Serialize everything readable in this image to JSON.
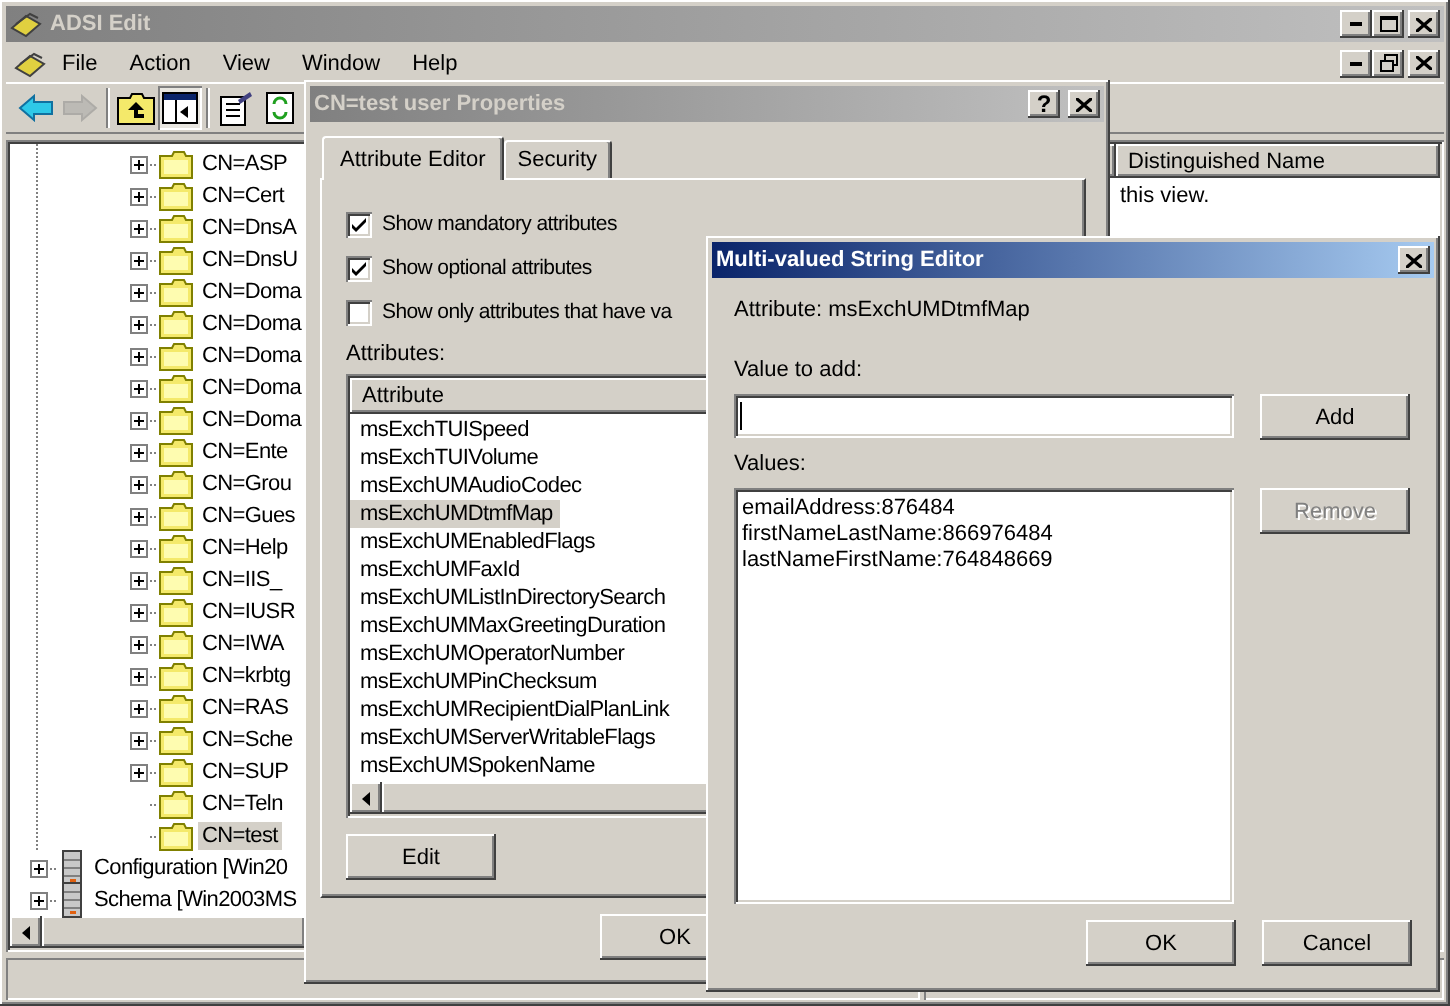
{
  "window": {
    "title": "ADSI Edit",
    "active": false
  },
  "menu": [
    {
      "label": "File"
    },
    {
      "label": "Action"
    },
    {
      "label": "View"
    },
    {
      "label": "Window"
    },
    {
      "label": "Help"
    }
  ],
  "toolbar": [
    {
      "kind": "back",
      "disabled": false
    },
    {
      "kind": "forward",
      "disabled": true
    },
    {
      "kind": "up",
      "disabled": false
    },
    {
      "kind": "tree",
      "disabled": false,
      "pressed": true
    },
    {
      "kind": "properties",
      "disabled": false
    },
    {
      "kind": "refresh",
      "disabled": false
    }
  ],
  "tree": {
    "folders": [
      {
        "label": "CN=ASP",
        "expandable": true,
        "selected": false
      },
      {
        "label": "CN=Cert",
        "expandable": true,
        "selected": false
      },
      {
        "label": "CN=DnsA",
        "expandable": true,
        "selected": false
      },
      {
        "label": "CN=DnsU",
        "expandable": true,
        "selected": false
      },
      {
        "label": "CN=Doma",
        "expandable": true,
        "selected": false
      },
      {
        "label": "CN=Doma",
        "expandable": true,
        "selected": false
      },
      {
        "label": "CN=Doma",
        "expandable": true,
        "selected": false
      },
      {
        "label": "CN=Doma",
        "expandable": true,
        "selected": false
      },
      {
        "label": "CN=Doma",
        "expandable": true,
        "selected": false
      },
      {
        "label": "CN=Ente",
        "expandable": true,
        "selected": false
      },
      {
        "label": "CN=Grou",
        "expandable": true,
        "selected": false
      },
      {
        "label": "CN=Gues",
        "expandable": true,
        "selected": false
      },
      {
        "label": "CN=Help",
        "expandable": true,
        "selected": false
      },
      {
        "label": "CN=IIS_",
        "expandable": true,
        "selected": false
      },
      {
        "label": "CN=IUSR",
        "expandable": true,
        "selected": false
      },
      {
        "label": "CN=IWA",
        "expandable": true,
        "selected": false
      },
      {
        "label": "CN=krbtg",
        "expandable": true,
        "selected": false
      },
      {
        "label": "CN=RAS",
        "expandable": true,
        "selected": false
      },
      {
        "label": "CN=Sche",
        "expandable": true,
        "selected": false
      },
      {
        "label": "CN=SUP",
        "expandable": true,
        "selected": false
      },
      {
        "label": "CN=Teln",
        "expandable": false,
        "selected": false
      },
      {
        "label": "CN=test",
        "expandable": false,
        "selected": true
      }
    ],
    "partitions": [
      {
        "label": "Configuration [Win20",
        "expandable": true
      },
      {
        "label": "Schema [Win2003MS",
        "expandable": true
      }
    ]
  },
  "list": {
    "columns": [
      {
        "label": "Distinguished Name"
      }
    ],
    "message": "this view."
  },
  "properties": {
    "title": "CN=test user Properties",
    "active": false,
    "help_button": "?",
    "tabs": [
      {
        "label": "Attribute Editor",
        "selected": true
      },
      {
        "label": "Security",
        "selected": false
      }
    ],
    "checkboxes": [
      {
        "label": "Show mandatory attributes",
        "checked": true
      },
      {
        "label": "Show optional attributes",
        "checked": true
      },
      {
        "label": "Show only attributes that have va",
        "checked": false
      }
    ],
    "attributes_label": "Attributes:",
    "attribute_column": "Attribute",
    "attributes": [
      {
        "name": "msExchTUISpeed",
        "selected": false
      },
      {
        "name": "msExchTUIVolume",
        "selected": false
      },
      {
        "name": "msExchUMAudioCodec",
        "selected": false
      },
      {
        "name": "msExchUMDtmfMap",
        "selected": true
      },
      {
        "name": "msExchUMEnabledFlags",
        "selected": false
      },
      {
        "name": "msExchUMFaxId",
        "selected": false
      },
      {
        "name": "msExchUMListInDirectorySearch",
        "selected": false
      },
      {
        "name": "msExchUMMaxGreetingDuration",
        "selected": false
      },
      {
        "name": "msExchUMOperatorNumber",
        "selected": false
      },
      {
        "name": "msExchUMPinChecksum",
        "selected": false
      },
      {
        "name": "msExchUMRecipientDialPlanLink",
        "selected": false
      },
      {
        "name": "msExchUMServerWritableFlags",
        "selected": false
      },
      {
        "name": "msExchUMSpokenName",
        "selected": false
      }
    ],
    "edit_button": "Edit",
    "ok_button": "OK"
  },
  "editor": {
    "title": "Multi-valued String Editor",
    "active": true,
    "attribute_label": "Attribute:",
    "attribute": "msExchUMDtmfMap",
    "value_label": "Value to add:",
    "add_button": {
      "label": "Add",
      "disabled": false
    },
    "values_label": "Values:",
    "values": [
      "emailAddress:876484",
      "firstNameLastName:866976484",
      "lastNameFirstName:764848669"
    ],
    "remove_button": {
      "label": "Remove",
      "disabled": true
    },
    "ok_button": "OK",
    "cancel_button": "Cancel"
  }
}
